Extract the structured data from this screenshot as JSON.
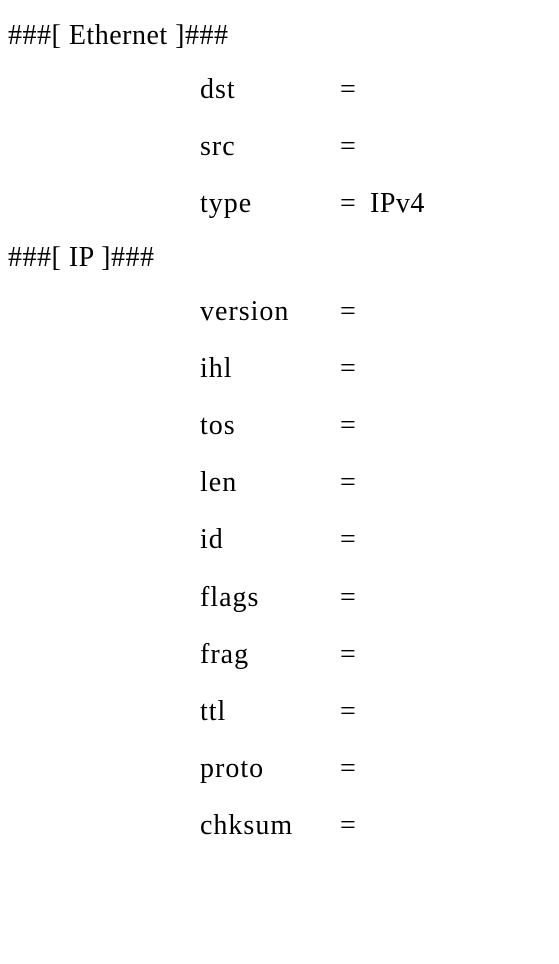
{
  "sections": [
    {
      "header": "###[ Ethernet ]###",
      "fields": [
        {
          "name": "dst",
          "value": ""
        },
        {
          "name": "src",
          "value": ""
        },
        {
          "name": "type",
          "value": "IPv4"
        }
      ]
    },
    {
      "header": "###[ IP ]###",
      "fields": [
        {
          "name": "version",
          "value": ""
        },
        {
          "name": "ihl",
          "value": ""
        },
        {
          "name": "tos",
          "value": ""
        },
        {
          "name": "len",
          "value": ""
        },
        {
          "name": "id",
          "value": ""
        },
        {
          "name": "flags",
          "value": ""
        },
        {
          "name": "frag",
          "value": ""
        },
        {
          "name": "ttl",
          "value": ""
        },
        {
          "name": "proto",
          "value": ""
        },
        {
          "name": "chksum",
          "value": ""
        }
      ]
    }
  ]
}
